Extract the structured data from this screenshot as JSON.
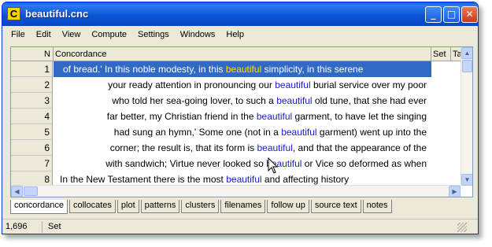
{
  "window": {
    "title": "beautiful.cnc",
    "app_icon_letter": "C"
  },
  "controls": {
    "minimize": "_",
    "maximize": "□",
    "close": "✕"
  },
  "menu": [
    "File",
    "Edit",
    "View",
    "Compute",
    "Settings",
    "Windows",
    "Help"
  ],
  "columns": {
    "n": "N",
    "concordance": "Concordance",
    "set": "Set",
    "tag": "Ta"
  },
  "rows": [
    {
      "n": "1",
      "left": "of bread.' In this noble modesty, in this ",
      "kw": "beautiful",
      "right": " simplicity, in this serene"
    },
    {
      "n": "2",
      "left": "your ready attention in pronouncing our ",
      "kw": "beautiful",
      "right": " burial service over my poor"
    },
    {
      "n": "3",
      "left": "who told her sea-going lover, to such a ",
      "kw": "beautiful",
      "right": " old tune, that she had ever"
    },
    {
      "n": "4",
      "left": "far better, my Christian friend in the ",
      "kw": "beautiful",
      "right": " garment, to have let the singing"
    },
    {
      "n": "5",
      "left": "had sung an hymn,' Some one (not in a ",
      "kw": "beautiful",
      "right": " garment) went up into the"
    },
    {
      "n": "6",
      "left": "corner; the result is, that its form is ",
      "kw": "beautiful",
      "right": ", and that the appearance of the"
    },
    {
      "n": "7",
      "left": "with sandwich; Virtue never looked so ",
      "kw": "beautiful",
      "right": " or Vice so deformed as when"
    },
    {
      "n": "8",
      "left": "In the New Testament there is the most ",
      "kw": "beautiful",
      "right": " and affecting history"
    }
  ],
  "tabs": [
    "concordance",
    "collocates",
    "plot",
    "patterns",
    "clusters",
    "filenames",
    "follow up",
    "source text",
    "notes"
  ],
  "status": {
    "count": "1,696",
    "mode": "Set"
  },
  "colors": {
    "selection": "#316ac5",
    "keyword": "#1a1acc",
    "selected_keyword": "#ffe000"
  }
}
